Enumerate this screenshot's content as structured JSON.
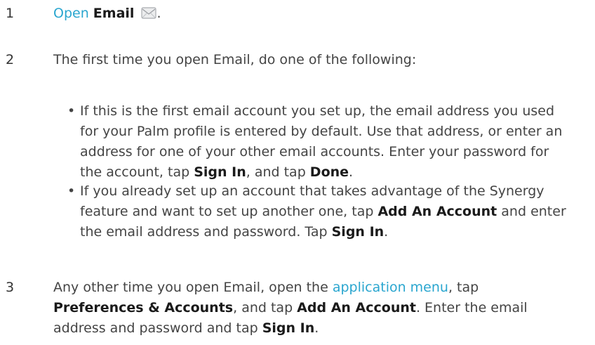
{
  "steps": [
    {
      "number": "1",
      "link": "Open",
      "bold": "Email",
      "icon": "email-envelope-icon",
      "after": "."
    },
    {
      "number": "2",
      "text": "The first time you open Email, do one of the following:",
      "bullets": [
        {
          "p1": "If this is the first email account you set up, the email address you used for your Palm profile is entered by default. Use that address, or enter an address for one of your other email accounts. Enter your password for the account, tap ",
          "b1": "Sign In",
          "p2": ", and tap ",
          "b2": "Done",
          "p3": "."
        },
        {
          "p1": "If you already set up an account that takes advantage of the Synergy feature and want to set up another one, tap ",
          "b1": "Add An Account",
          "p2": " and enter the email address and password. Tap ",
          "b2": "Sign In",
          "p3": "."
        }
      ]
    },
    {
      "number": "3",
      "p1": "Any other time you open Email, open the ",
      "link": "application menu",
      "p2": ", tap ",
      "b1": "Preferences & Accounts",
      "p3": ", and tap ",
      "b2": "Add An Account",
      "p4": ". Enter the email address and password and tap ",
      "b3": "Sign In",
      "p5": "."
    }
  ],
  "colors": {
    "link": "#2aa6cf",
    "text": "#444444",
    "bold": "#1a1a1a"
  }
}
